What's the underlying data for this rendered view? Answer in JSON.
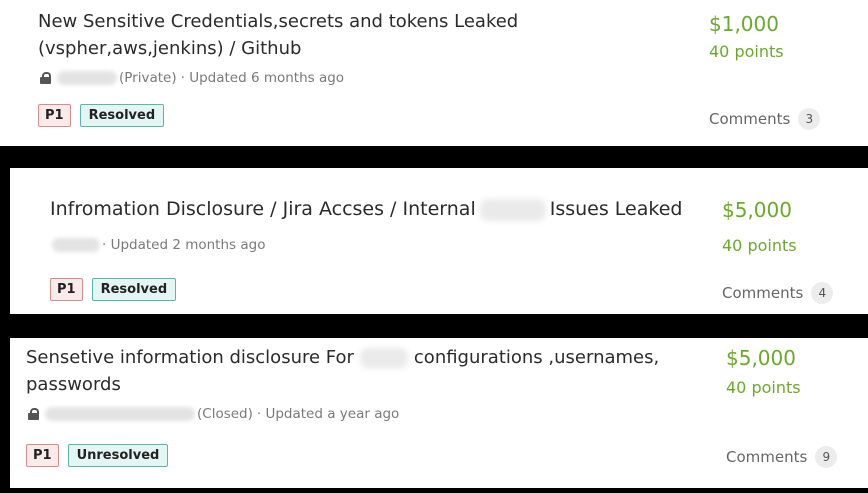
{
  "reports": [
    {
      "title_line1": "New Sensitive Credentials,secrets and tokens Leaked",
      "title_line2": "(vspher,aws,jenkins) / Github",
      "visibility": "(Private)",
      "updated": "· Updated 6 months ago",
      "severity": "P1",
      "status": "Resolved",
      "bounty": "$1,000",
      "points": "40 points",
      "comments_label": "Comments",
      "comments_count": "3"
    },
    {
      "title_part1": "Infromation Disclosure / Jira Accses / Internal",
      "title_part2": "Issues Leaked",
      "updated": "· Updated 2 months ago",
      "severity": "P1",
      "status": "Resolved",
      "bounty": "$5,000",
      "points": "40 points",
      "comments_label": "Comments",
      "comments_count": "4"
    },
    {
      "title_part1": "Sensetive information disclosure For",
      "title_part2": "configurations ,usernames,",
      "title_line2": "passwords",
      "visibility": "(Closed)",
      "updated": "· Updated a year ago",
      "severity": "P1",
      "status": "Unresolved",
      "bounty": "$5,000",
      "points": "40 points",
      "comments_label": "Comments",
      "comments_count": "9"
    }
  ],
  "colors": {
    "accent_green": "#6aaa2a",
    "p1_border": "#d98b8b",
    "status_border": "#58b8a8"
  }
}
